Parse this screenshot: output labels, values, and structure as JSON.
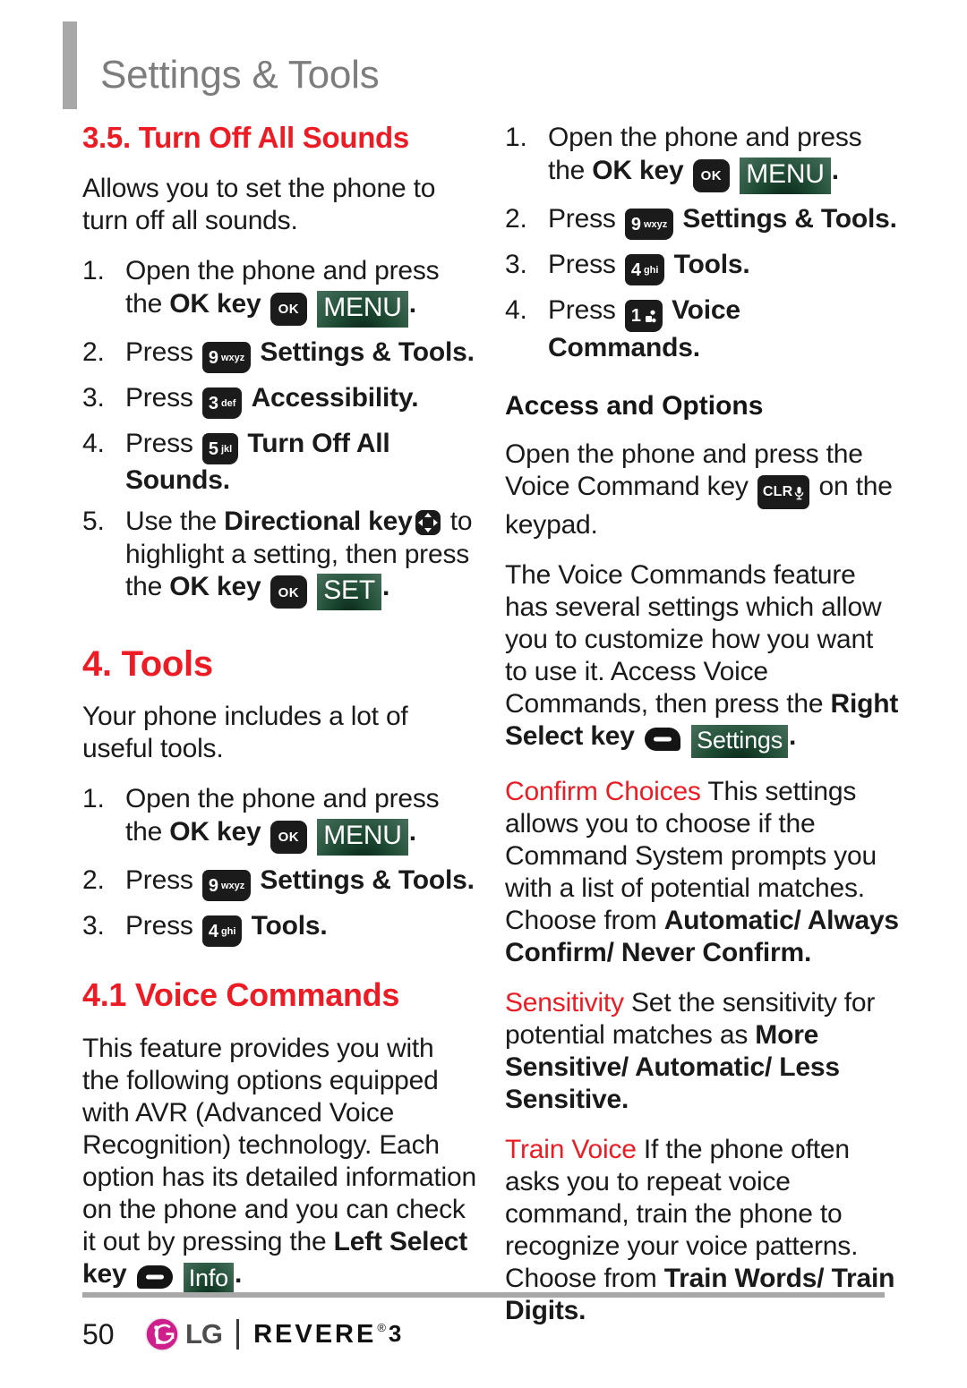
{
  "header": {
    "title": "Settings & Tools"
  },
  "colors": {
    "accent_red": "#ed1c24",
    "header_gray": "#7d7d7d",
    "badge_green": "#1d4a33",
    "key_black": "#1b1b1b",
    "lg_magenta": "#cf1f8c"
  },
  "left_column": {
    "section_1": {
      "heading": "3.5. Turn Off All Sounds",
      "intro": "Allows you to set the phone to turn off all sounds.",
      "steps": [
        {
          "num": "1.",
          "pre": "Open the phone and press the ",
          "bold": "OK key",
          "keys": [
            "ok-key",
            "menu-badge"
          ],
          "key_labels": {
            "ok": "OK",
            "badge": "MENU"
          },
          "post": "."
        },
        {
          "num": "2.",
          "pre": "Press ",
          "key_digit": "9",
          "key_letters": "wxyz",
          "bold": "Settings & Tools",
          "post": "."
        },
        {
          "num": "3.",
          "pre": "Press ",
          "key_digit": "3",
          "key_letters": "def",
          "bold": "Accessibility",
          "post": "."
        },
        {
          "num": "4.",
          "pre": "Press ",
          "key_digit": "5",
          "key_letters": "jkl",
          "bold": "Turn Off All Sounds",
          "post": "."
        },
        {
          "num": "5.",
          "pre": "Use the ",
          "bold": "Directional key",
          "mid": " to highlight a setting, then press the ",
          "bold2": "OK key",
          "key_labels": {
            "ok": "OK",
            "badge": "SET"
          },
          "post": "."
        }
      ]
    },
    "section_2": {
      "heading": "4. Tools",
      "intro": "Your phone includes a lot of useful tools.",
      "steps": [
        {
          "num": "1.",
          "pre": "Open the phone and press the ",
          "bold": "OK key",
          "key_labels": {
            "ok": "OK",
            "badge": "MENU"
          },
          "post": "."
        },
        {
          "num": "2.",
          "pre": "Press ",
          "key_digit": "9",
          "key_letters": "wxyz",
          "bold": "Settings & Tools",
          "post": "."
        },
        {
          "num": "3.",
          "pre": "Press ",
          "key_digit": "4",
          "key_letters": "ghi",
          "bold": "Tools",
          "post": "."
        }
      ]
    },
    "section_3": {
      "heading": "4.1 Voice Commands",
      "para_a": "This feature provides you with the following options equipped with AVR (Advanced Voice Recognition) technology. Each option has its detailed information on the phone and you can check it out by pressing the ",
      "para_a_bold": "Left Select key",
      "para_a_badge": "Info",
      "para_a_end": "."
    }
  },
  "right_column": {
    "steps": [
      {
        "num": "1.",
        "pre": "Open the phone and press the ",
        "bold": "OK key",
        "key_labels": {
          "ok": "OK",
          "badge": "MENU"
        },
        "post": "."
      },
      {
        "num": "2.",
        "pre": "Press ",
        "key_digit": "9",
        "key_letters": "wxyz",
        "bold": "Settings & Tools",
        "post": "."
      },
      {
        "num": "3.",
        "pre": "Press ",
        "key_digit": "4",
        "key_letters": "ghi",
        "bold": "Tools",
        "post": "."
      },
      {
        "num": "4.",
        "pre": "Press ",
        "key_digit": "1",
        "key_letters": "",
        "bold": "Voice Commands",
        "post": "."
      }
    ],
    "access_heading": "Access and Options",
    "access_para_pre": "Open the phone and press the Voice Command key ",
    "access_key": "CLR",
    "access_para_post": " on the keypad.",
    "settings_para_pre": "The Voice Commands feature has several settings which allow you to customize how you want to use it. Access Voice Commands, then press the ",
    "settings_para_bold": "Right Select key",
    "settings_badge": "Settings",
    "settings_para_post": ".",
    "options": [
      {
        "term": "Confirm Choices",
        "text_pre": " This settings allows you to choose if the Command System prompts you with a list of potential matches. Choose from ",
        "bold": "Automatic/ Always Confirm/ Never Confirm",
        "text_post": "."
      },
      {
        "term": "Sensitivity",
        "text_pre": "  Set the sensitivity for potential matches as ",
        "bold": "More Sensitive/ Automatic/ Less Sensitive",
        "text_post": "."
      },
      {
        "term": "Train Voice",
        "text_pre": "  If the phone often asks you to repeat voice command, train the phone to recognize your voice patterns. Choose from ",
        "bold": "Train Words/ Train Digits",
        "text_post": "."
      }
    ]
  },
  "footer": {
    "page_number": "50",
    "brand_lg": "LG",
    "brand_model": "REVERE",
    "brand_reg": "®",
    "brand_version": "3"
  }
}
